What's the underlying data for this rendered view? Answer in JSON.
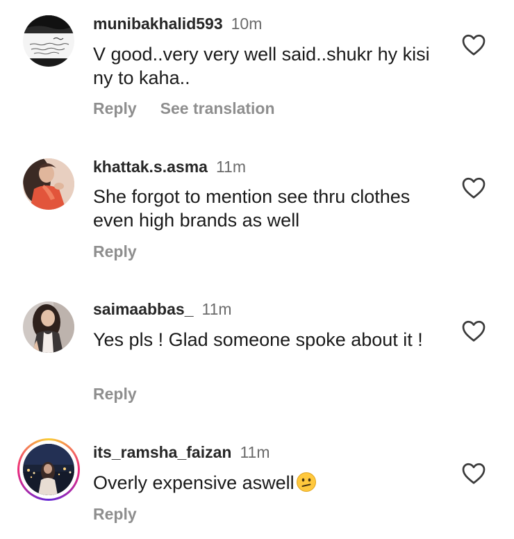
{
  "comments": [
    {
      "username": "munibakhalid593",
      "time": "10m",
      "text": "V good..very very well said..shukr hy kisi ny to kaha..",
      "reply_label": "Reply",
      "translate_label": "See translation",
      "avatar_icon": "urdu-text-avatar"
    },
    {
      "username": "khattak.s.asma",
      "time": "11m",
      "text": "She forgot to mention see thru clothes even high brands as well",
      "reply_label": "Reply",
      "avatar_icon": "woman-red-dress-avatar"
    },
    {
      "username": "saimaabbas_",
      "time": "11m",
      "text": "Yes pls ! Glad someone spoke about it !",
      "reply_label": "Reply",
      "avatar_icon": "woman-portrait-avatar"
    },
    {
      "username": "its_ramsha_faizan",
      "time": "11m",
      "text": "Overly expensive aswell",
      "emoji": "confused-face-emoji",
      "reply_label": "Reply",
      "avatar_icon": "night-city-avatar",
      "has_story_ring": true
    }
  ],
  "colors": {
    "username": "#262626",
    "meta": "#8e8e8e",
    "story_ring_start": "#f9ce34",
    "story_ring_mid": "#ee2a7b"
  }
}
